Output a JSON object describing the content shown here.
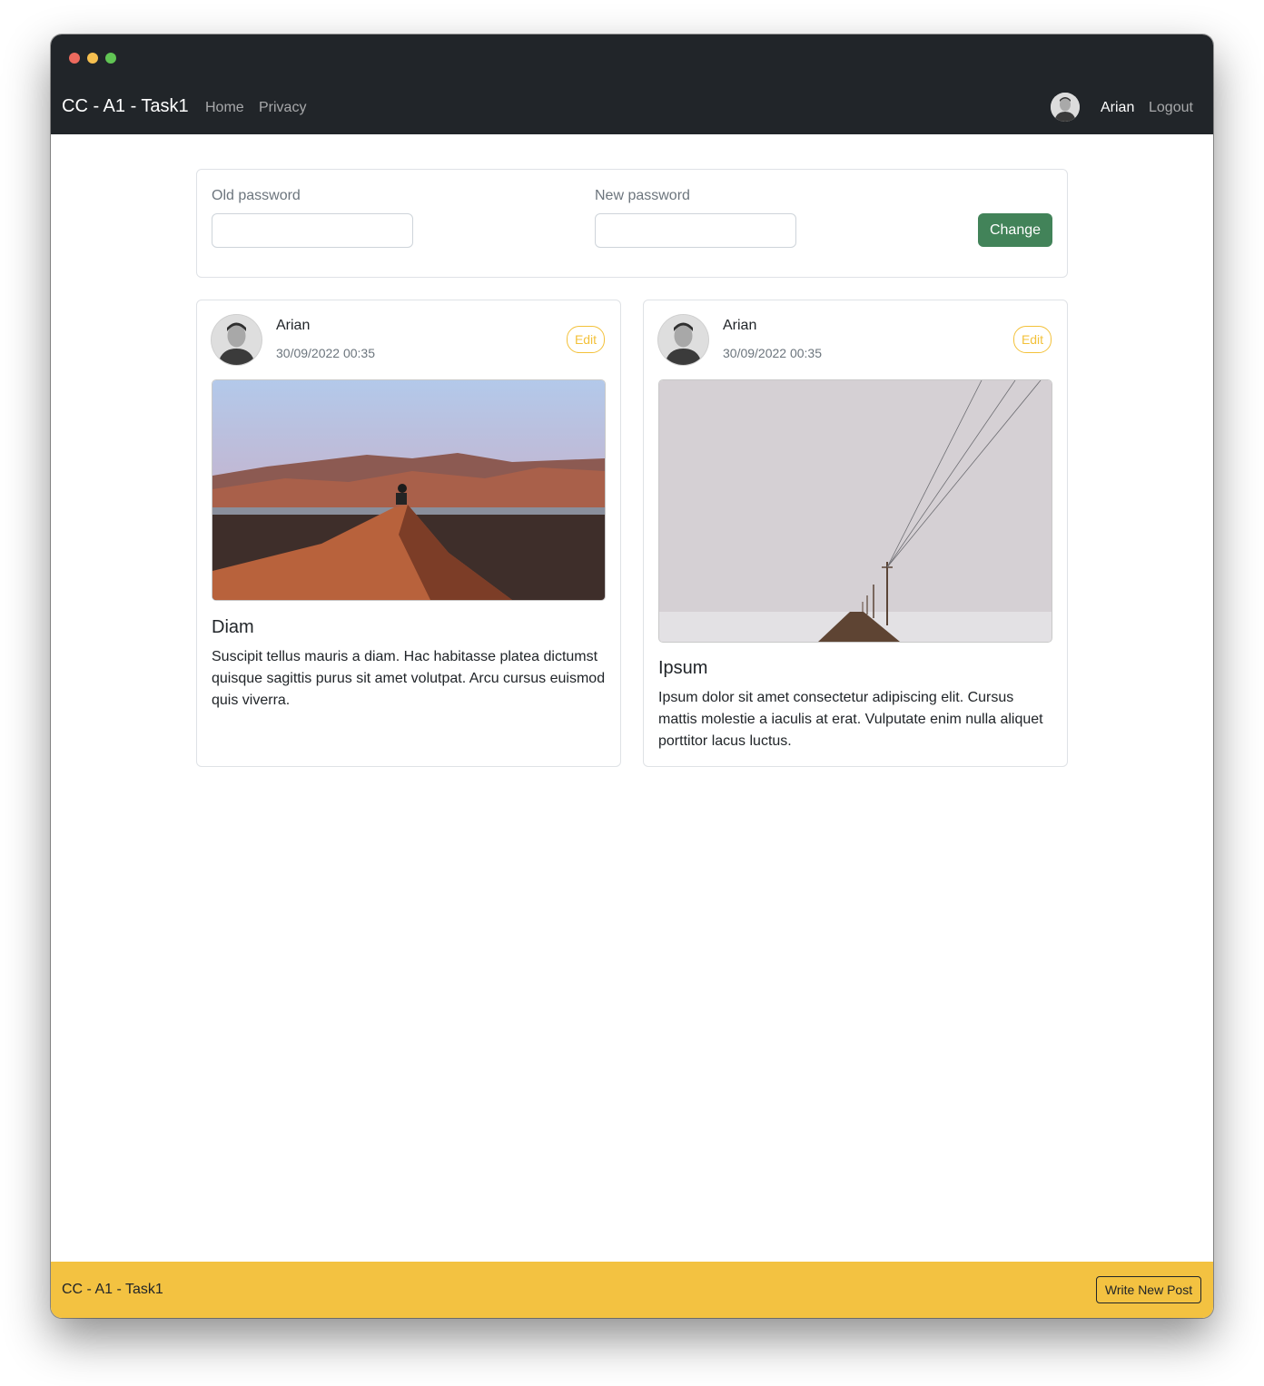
{
  "app": {
    "brand": "CC - A1 - Task1"
  },
  "nav": {
    "links": [
      "Home",
      "Privacy"
    ],
    "user_name": "Arian",
    "logout": "Logout"
  },
  "password_form": {
    "old_label": "Old password",
    "new_label": "New password",
    "old_value": "",
    "new_value": "",
    "submit_label": "Change"
  },
  "posts": [
    {
      "author": "Arian",
      "date": "30/09/2022 00:35",
      "edit_label": "Edit",
      "title": "Diam",
      "body": "Suscipit tellus mauris a diam. Hac habitasse platea dictumst quisque sagittis purus sit amet volutpat. Arcu cursus euismod quis viverra."
    },
    {
      "author": "Arian",
      "date": "30/09/2022 00:35",
      "edit_label": "Edit",
      "title": "Ipsum",
      "body": "Ipsum dolor sit amet consectetur adipiscing elit. Cursus mattis molestie a iaculis at erat. Vulputate enim nulla aliquet porttitor lacus luctus."
    }
  ],
  "footer": {
    "brand": "CC - A1 - Task1",
    "write_label": "Write New Post"
  },
  "colors": {
    "navbar": "#212529",
    "success": "#428359",
    "warning": "#f3c241"
  }
}
